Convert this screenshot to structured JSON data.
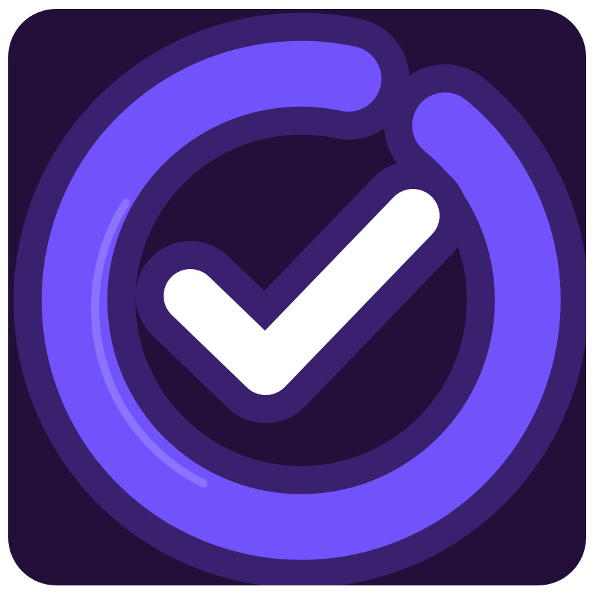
{
  "icon": {
    "name": "progress-ring-checkmark",
    "glyph": "check-icon",
    "colors": {
      "background": "#230f39",
      "ring_shadow": "#3a2170",
      "ring": "#7252fb",
      "ring_highlight": "#8a73ff",
      "check": "#ffffff"
    }
  }
}
